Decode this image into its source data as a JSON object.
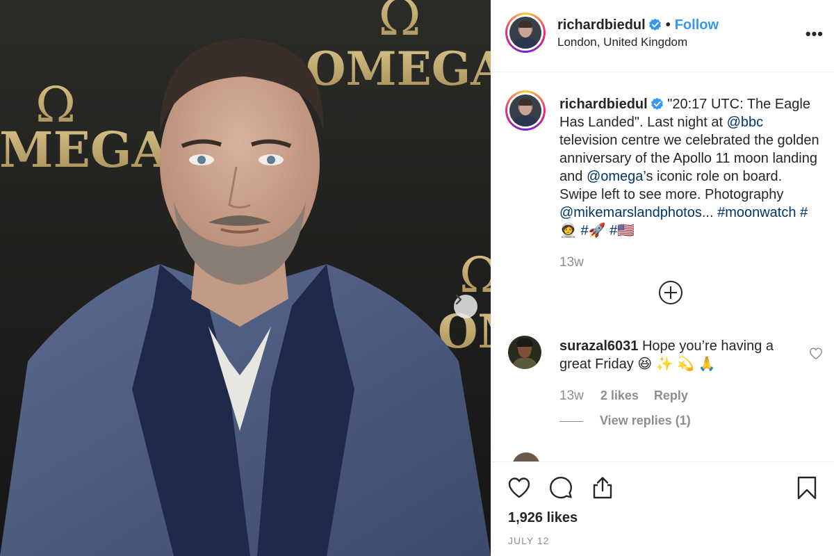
{
  "post": {
    "author": "richardbiedul",
    "verified": true,
    "follow_label": "Follow",
    "separator": "•",
    "location": "London, United Kingdom",
    "more_label": "•••",
    "image_brand_text": "OMEGA",
    "image_brand_symbol": "Ω"
  },
  "caption": {
    "author": "richardbiedul",
    "part1": " \"20:17 UTC: The Eagle Has Landed\". Last night at ",
    "mention1": "@bbc",
    "part2": " television centre we celebrated the golden anniversary of the Apollo 11 moon landing and ",
    "mention2": "@omega",
    "part3": "’s iconic role on board. Swipe left to see more. Photography ",
    "mention3": "@mikemarslandphotos",
    "part4": "... ",
    "hashtag1": "#moonwatch",
    "part5": " ",
    "hashtag2": "#🧑‍🚀",
    "part6": "  ",
    "hashtag3": "#🚀",
    "part7": "  ",
    "hashtag4": "#🇺🇸",
    "time": "13w"
  },
  "comments": [
    {
      "user": "surazal6031",
      "text": " Hope you’re having a great Friday 😆 ✨ 💫 🙏",
      "time": "13w",
      "likes": "2 likes",
      "reply_label": "Reply",
      "view_replies": "View replies (1)"
    }
  ],
  "footer": {
    "likes": "1,926 likes",
    "date": "JULY 12"
  },
  "icons": {
    "verified": "verified-badge-icon",
    "like": "heart-icon",
    "comment": "comment-bubble-icon",
    "share": "share-icon",
    "save": "bookmark-icon",
    "load_more": "plus-circle-icon",
    "next": "chevron-right-icon",
    "more": "more-options-icon"
  },
  "colors": {
    "link": "#003569",
    "follow": "#3897f0",
    "verified": "#3897f0",
    "muted": "#8e8e8e",
    "text": "#262626"
  }
}
